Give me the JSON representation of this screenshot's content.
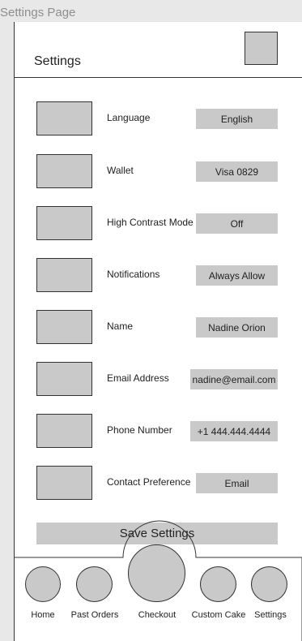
{
  "frame": {
    "title": "Settings Page"
  },
  "header": {
    "title": "Settings"
  },
  "settings": {
    "language": {
      "label": "Language",
      "value": "English"
    },
    "wallet": {
      "label": "Wallet",
      "value": "Visa 0829"
    },
    "contrast": {
      "label": "High Contrast Mode",
      "value": "Off"
    },
    "notifications": {
      "label": "Notifications",
      "value": "Always Allow"
    },
    "name": {
      "label": "Name",
      "value": "Nadine Orion"
    },
    "email": {
      "label": "Email Address",
      "value": "nadine@email.com"
    },
    "phone": {
      "label": "Phone Number",
      "value": "+1 444.444.4444"
    },
    "contact": {
      "label": "Contact Preference",
      "value": "Email"
    }
  },
  "save_label": "Save Settings",
  "tabs": {
    "home": "Home",
    "past_orders": "Past Orders",
    "checkout": "Checkout",
    "custom_cake": "Custom Cake",
    "settings": "Settings"
  },
  "colors": {
    "placeholder": "#c9c9c9",
    "frame_background": "#e8e8e8",
    "stroke": "#333333"
  }
}
